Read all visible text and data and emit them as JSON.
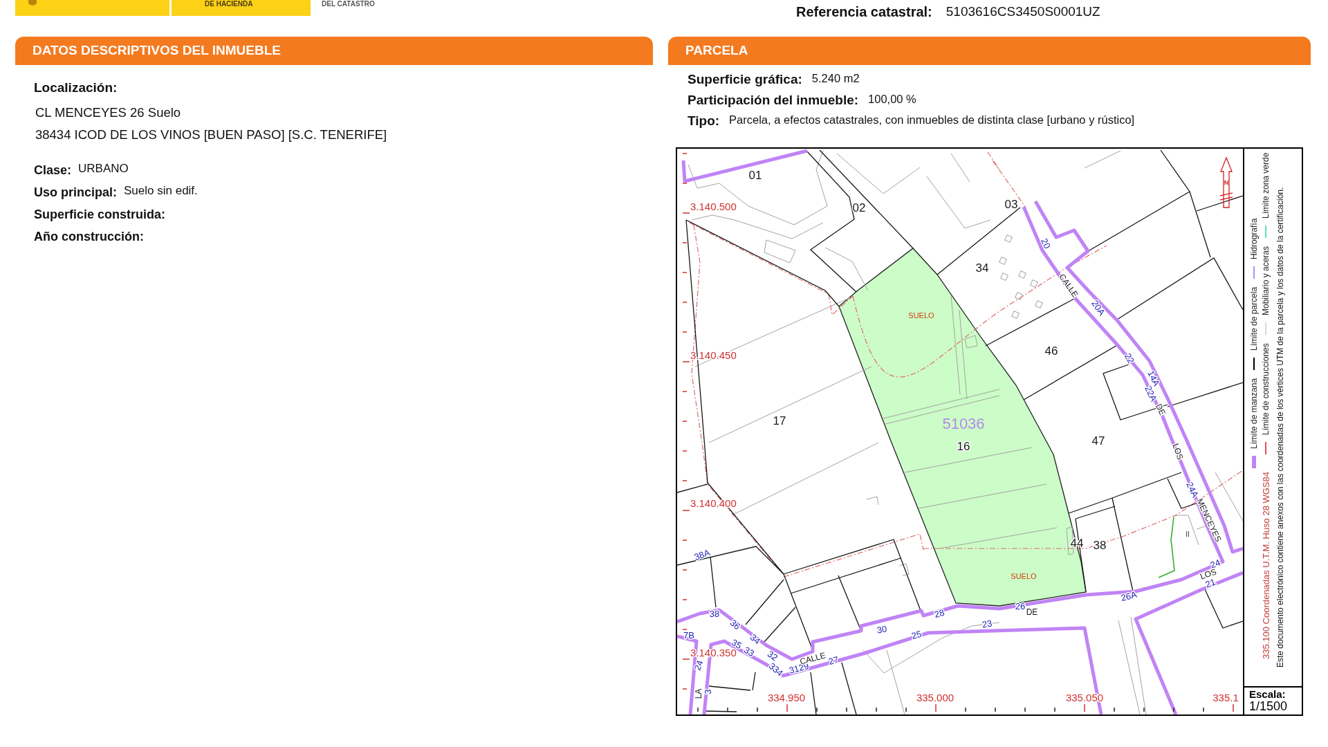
{
  "header": {
    "logo": {
      "ministry": "DE HACIENDA",
      "office": "DEL CATASTRO"
    },
    "reference": {
      "label": "Referencia catastral:",
      "value": "5103616CS3450S0001UZ"
    }
  },
  "inmueble": {
    "title": "DATOS DESCRIPTIVOS DEL **INMUEBLE**",
    "location": {
      "label": "Localización:",
      "lines": [
        "CL MENCEYES 26 Suelo",
        "38434 ICOD DE LOS VINOS [BUEN PASO] [S.C. TENERIFE]"
      ]
    },
    "fields": [
      {
        "label": "Clase:",
        "value": "URBANO"
      },
      {
        "label": "Uso principal:",
        "value": "Suelo sin edif."
      },
      {
        "label": "Superficie construida:"
      },
      {
        "label": "Año construcción:"
      }
    ]
  },
  "parcela": {
    "title": "PARCELA",
    "fields": [
      {
        "label": "Superficie gráfica:",
        "value": "5.240 m2"
      },
      {
        "label": "Participación del inmueble:",
        "value": "100,00 %"
      },
      {
        "label": "Tipo:",
        "value": "Parcela, a efectos catastrales, con inmuebles de distinta clase [urbano y rústico]"
      }
    ],
    "map": {
      "parcel_numbers": [
        "01",
        "02",
        "03",
        "34",
        "46",
        "17",
        "16",
        "47",
        "44",
        "38"
      ],
      "parcel_reference": "51036",
      "land_use_labels": [
        "SUELO",
        "SUELO"
      ],
      "northing_labels": [
        "3.140.500",
        "3.140.450",
        "3.140.400",
        "3.140.350"
      ],
      "easting_labels": [
        "334.950",
        "335.000",
        "335.050",
        "335.1"
      ],
      "house_numbers": [
        "20",
        "20A",
        "22",
        "14A",
        "22A",
        "24A",
        "24",
        "21",
        "26A",
        "26",
        "28",
        "23",
        "25",
        "30",
        "27",
        "3129",
        "334",
        "32",
        "33",
        "35",
        "34",
        "36",
        "38",
        "38A",
        "7B",
        "24",
        "3"
      ],
      "street_names": [
        "CALLE",
        "DE",
        "LOS",
        "MENCEYES",
        "LOS",
        "DE",
        "CALLE",
        "LA"
      ],
      "floor_labels": [
        "II"
      ],
      "north_label": "N"
    },
    "legend": {
      "columns": [
        {
          "items": [
            {
              "label": "Límite de manzana",
              "color": "#c084f5",
              "kind": "band"
            },
            {
              "label": "Límite de parcela",
              "color": "#000000",
              "kind": "line"
            },
            {
              "label": "Hidrografía",
              "color": "#9a9af5",
              "kind": "line"
            }
          ]
        },
        {
          "items": [
            {
              "label": "Límite de construcciones",
              "color": "#e05050",
              "kind": "line"
            },
            {
              "label": "Mobiliario y aceras",
              "color": "#d8d8d8",
              "kind": "line"
            },
            {
              "label": "Límite zona verde",
              "color": "#5ee0b8",
              "kind": "line"
            }
          ]
        }
      ],
      "coordinates_note": "335.100 Coordenadas U.T.M. Huso 28 WGS84",
      "notice": "Este documento electrónico contiene anexos con las coordenadas de los vértices UTM de la parcela y los datos de la certificación.",
      "scale_label": "Escala:",
      "scale": "1/1500"
    }
  }
}
